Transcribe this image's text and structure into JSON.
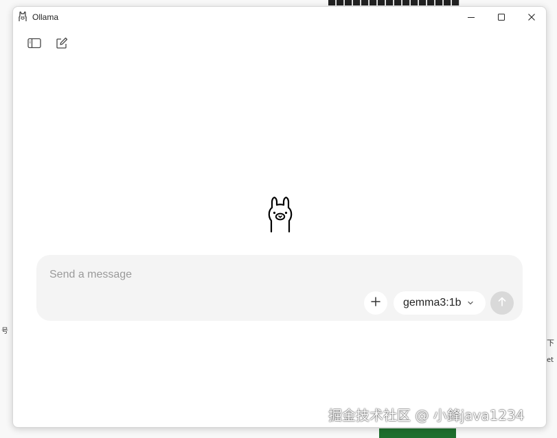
{
  "window": {
    "title": "Ollama",
    "buttons": {
      "minimize_icon": "minimize-icon",
      "maximize_icon": "maximize-icon",
      "close_icon": "close-icon"
    }
  },
  "toolbar": {
    "sidebar_icon": "sidebar-toggle-icon",
    "new_chat_icon": "new-chat-icon"
  },
  "main": {
    "logo_icon": "ollama-llama-icon"
  },
  "composer": {
    "placeholder": "Send a message",
    "value": "",
    "attach_icon": "plus-icon",
    "model": "gemma3:1b",
    "model_chevron_icon": "chevron-down-icon",
    "send_icon": "arrow-up-icon",
    "colors": {
      "background": "#f4f4f4",
      "send_disabled": "#d9d9d9"
    }
  },
  "background": {
    "watermark": "掘金技术社区 @ 小鋒java1234",
    "left_fragment": "号",
    "right_fragment_1": "下",
    "right_fragment_2": "et"
  }
}
